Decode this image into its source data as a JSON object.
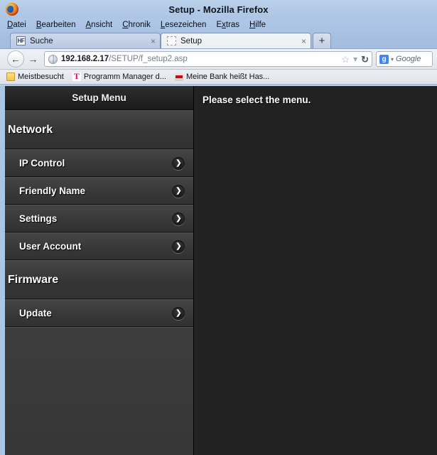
{
  "window": {
    "title": "Setup - Mozilla Firefox",
    "logo_icon": "firefox-logo-icon"
  },
  "menubar": {
    "items": [
      {
        "label": "Datei",
        "access_key": "D"
      },
      {
        "label": "Bearbeiten",
        "access_key": "B"
      },
      {
        "label": "Ansicht",
        "access_key": "A"
      },
      {
        "label": "Chronik",
        "access_key": "C"
      },
      {
        "label": "Lesezeichen",
        "access_key": "L"
      },
      {
        "label": "Extras",
        "access_key": "x"
      },
      {
        "label": "Hilfe",
        "access_key": "H"
      }
    ]
  },
  "tabs": {
    "items": [
      {
        "label": "Suche",
        "favicon": "hf-favicon",
        "favicon_text": "HF",
        "active": false,
        "close_label": "×"
      },
      {
        "label": "Setup",
        "favicon": "blank-favicon",
        "favicon_text": "",
        "active": true,
        "close_label": "×"
      }
    ],
    "new_tab_label": "+"
  },
  "navbar": {
    "back_icon": "back-arrow-icon",
    "back_label": "←",
    "forward_icon": "forward-arrow-icon",
    "forward_label": "→",
    "site_icon": "globe-icon",
    "url_host": "192.168.2.17",
    "url_path": "/SETUP/f_setup2.asp",
    "bookmark_star_label": "☆",
    "dropdown_label": "▾",
    "reload_label": "↻",
    "search": {
      "engine_icon": "google-icon",
      "engine_letter": "g",
      "caret": "▾",
      "placeholder": "Google"
    }
  },
  "bookmarks": {
    "items": [
      {
        "label": "Meistbesucht",
        "icon": "folder-icon"
      },
      {
        "label": "Programm Manager d...",
        "icon": "telekom-icon",
        "icon_text": "T"
      },
      {
        "label": "Meine Bank heißt Has...",
        "icon": "bank-icon"
      }
    ]
  },
  "page": {
    "sidebar": {
      "header": "Setup Menu",
      "groups": [
        {
          "title": "Network",
          "items": [
            {
              "label": "IP Control",
              "chevron": "❯"
            },
            {
              "label": "Friendly Name",
              "chevron": "❯"
            },
            {
              "label": "Settings",
              "chevron": "❯"
            },
            {
              "label": "User Account",
              "chevron": "❯"
            }
          ]
        },
        {
          "title": "Firmware",
          "items": [
            {
              "label": "Update",
              "chevron": "❯"
            }
          ]
        }
      ]
    },
    "content": {
      "message": "Please select the menu."
    }
  },
  "colors": {
    "titlebar": "#b0c7e6",
    "page_background": "#222222",
    "sidebar_row": "#3a3a3a",
    "sidebar_header": "#232323",
    "text_light": "#ffffff",
    "telekom_magenta": "#e20074",
    "google_blue": "#4285f4"
  }
}
